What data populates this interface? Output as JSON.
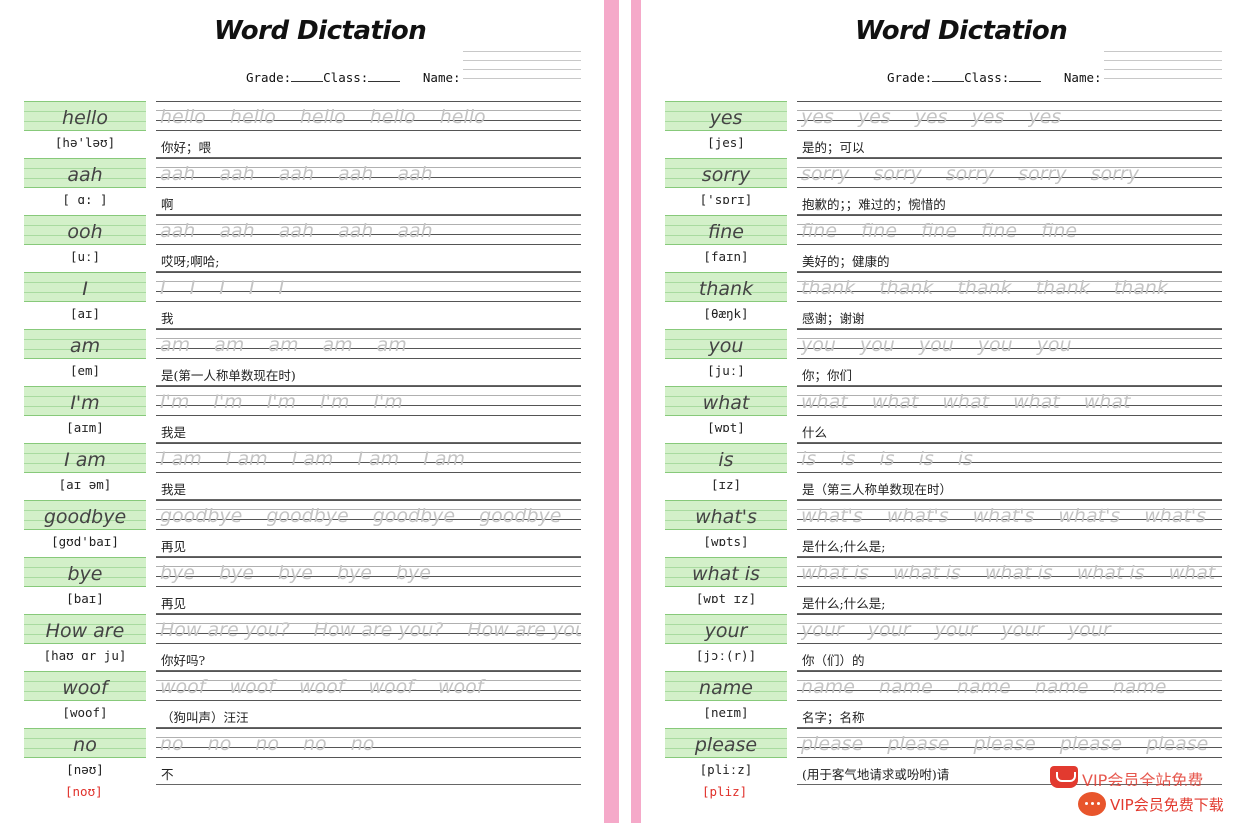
{
  "colors": {
    "pink": "#f5a9c9",
    "green_fill": "#d3f0c9",
    "red": "#e0302a"
  },
  "left": {
    "title": "Word Dictation",
    "grade_label": "Grade:",
    "class_label": "Class:",
    "name_label": "Name:",
    "extra_phonetic": "[noʊ]",
    "words": [
      {
        "word": "hello",
        "phonetic": "[hə'ləʊ]",
        "meaning": "你好；喂"
      },
      {
        "word": "aah",
        "phonetic": "[ ɑ: ]",
        "meaning": "啊"
      },
      {
        "word": "ooh",
        "phonetic": "[uː]",
        "meaning": "哎呀;啊哈;"
      },
      {
        "word": "I",
        "phonetic": "[aɪ]",
        "meaning": "我"
      },
      {
        "word": "am",
        "phonetic": "[em]",
        "meaning": "是(第一人称单数现在时)"
      },
      {
        "word": "I'm",
        "phonetic": "[aɪm]",
        "meaning": "我是"
      },
      {
        "word": "I am",
        "phonetic": "[aɪ əm]",
        "meaning": "我是"
      },
      {
        "word": "goodbye",
        "phonetic": "[gʊd'baɪ]",
        "meaning": "再见"
      },
      {
        "word": "bye",
        "phonetic": "[baɪ]",
        "meaning": "再见"
      },
      {
        "word": "How are",
        "phonetic": "[haʊ ɑr ju]",
        "meaning": "你好吗?"
      },
      {
        "word": "woof",
        "phonetic": "[woof]",
        "meaning": "（狗叫声）汪汪"
      },
      {
        "word": "no",
        "phonetic": "[nəʊ]",
        "meaning": "不"
      }
    ],
    "traces": [
      "hello",
      "aah",
      "aah",
      "I",
      "am",
      "I'm",
      "I am",
      "goodbye",
      "bye",
      "How are you?",
      "woof",
      "no"
    ]
  },
  "right": {
    "title": "Word Dictation",
    "grade_label": "Grade:",
    "class_label": "Class:",
    "name_label": "Name:",
    "extra_phonetic": "[pliz]",
    "words": [
      {
        "word": "yes",
        "phonetic": "[jes]",
        "meaning": "是的；可以"
      },
      {
        "word": "sorry",
        "phonetic": "['sɒrɪ]",
        "meaning": "抱歉的；；难过的；惋惜的"
      },
      {
        "word": "fine",
        "phonetic": "[faɪn]",
        "meaning": "美好的；健康的"
      },
      {
        "word": "thank",
        "phonetic": "[θæŋk]",
        "meaning": "感谢；谢谢"
      },
      {
        "word": "you",
        "phonetic": "[juː]",
        "meaning": "你；你们"
      },
      {
        "word": "what",
        "phonetic": "[wɒt]",
        "meaning": "什么"
      },
      {
        "word": "is",
        "phonetic": "[ɪz]",
        "meaning": "是（第三人称单数现在时）"
      },
      {
        "word": "what's",
        "phonetic": "[wɒts]",
        "meaning": "是什么;什么是;"
      },
      {
        "word": "what is",
        "phonetic": "[wɒt ɪz]",
        "meaning": "是什么;什么是;"
      },
      {
        "word": "your",
        "phonetic": "[jɔː(r)]",
        "meaning": "你（们）的"
      },
      {
        "word": "name",
        "phonetic": "[neɪm]",
        "meaning": "名字；名称"
      },
      {
        "word": "please",
        "phonetic": "[pliːz]",
        "meaning": "(用于客气地请求或吩咐)请"
      }
    ],
    "traces": [
      "yes",
      "sorry",
      "fine",
      "thank",
      "you",
      "what",
      "is",
      "what's",
      "what is",
      "your",
      "name",
      "please"
    ]
  },
  "watermark": {
    "top_text": "VIP会员全站免费",
    "text": "VIP会员免费下载"
  }
}
